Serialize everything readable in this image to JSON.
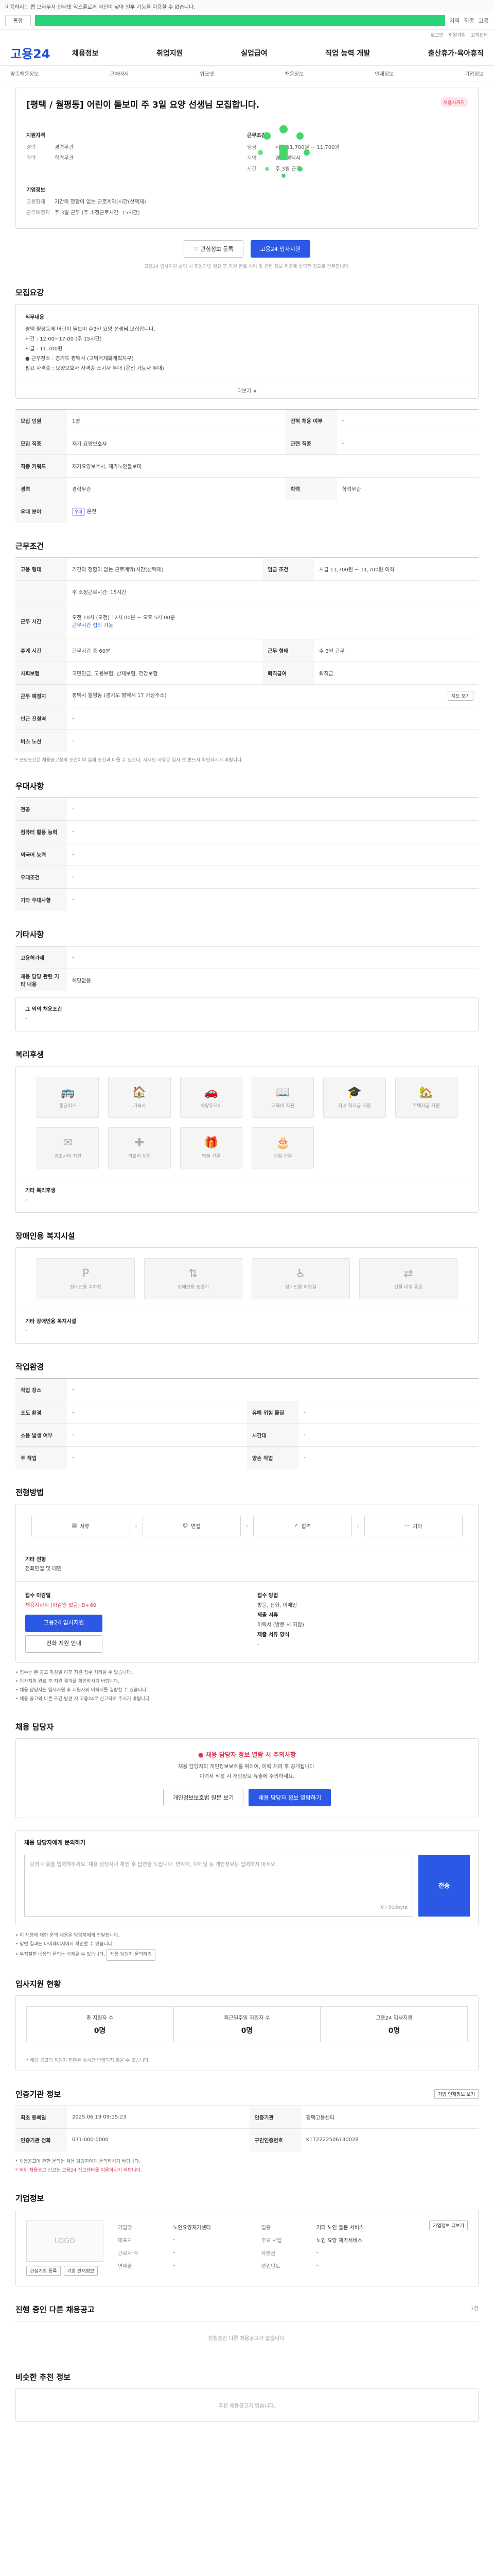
{
  "top_notice": "이용하시는 웹 브라우저 인터넷 익스플로러 버전이 낮아 일부 기능을 이용할 수 없습니다.",
  "search": {
    "scope": "통합",
    "icons": [
      "지역",
      "직종",
      "고용"
    ]
  },
  "top_links": [
    "로그인",
    "회원가입",
    "고객센터"
  ],
  "logo": "고용24",
  "gnb": [
    "채용정보",
    "취업지원",
    "실업급여",
    "직업 능력 개발",
    "출산휴가·육아휴직"
  ],
  "subnav": [
    "맞춤채용정보",
    "근처에서",
    "워크넷",
    "채용정보",
    "인재정보",
    "기업정보"
  ],
  "job": {
    "title": "[평택 / 월평동] 어린이 돌보미 주 3일 요양 선생님 모집합니다.",
    "badge": "채용시까지",
    "recruit_label": "지원자격",
    "conditions_label": "근무조건",
    "company_label": "기업정보",
    "career_k": "경력",
    "career_v": "경력무관",
    "edu_k": "학력",
    "edu_v": "학력무관",
    "wage_k": "임금",
    "wage_v": "시급 11,700원 ~ 11,700원",
    "region_k": "지역",
    "region_v": "경기 평택시",
    "time_k": "시간",
    "time_v": "주 3일 근무",
    "emp_k": "고용형태",
    "emp_v": "기간의 정함이 없는 근로계약(시간(선택제)",
    "loc_k": "근무예정지",
    "loc_v": "주 3일 근무 (주 소정근로시간: 15시간)",
    "btn_save": "관심정보 등록",
    "btn_apply": "고용24 입사지원",
    "notice": "고용24 입사지원 클릭 시 회원가입 필요 후 지원 완료 처리 및 관련 정보 제공에 동의한 것으로 간주합니다."
  },
  "detail": {
    "title": "모집요강",
    "text_title": "직무내용",
    "lines": [
      "평택 월평동에 어린이 돌보미 주3일 요양 선생님 모집합니다.",
      "시간 : 12:00~17:00 (주 15시간)",
      "시급 : 11,700원",
      "● 근무장소 : 경기도 평택시 (고덕국제화계획지구)",
      "필요 자격증 : 요양보호사 자격증 소지자 우대 (운전 가능자 우대)"
    ],
    "more": "더보기 ∨",
    "rows": [
      [
        "모집 인원",
        "1명",
        "전혀 채용 여부",
        "-"
      ],
      [
        "모집 직종",
        "재가 요양보호사",
        "관련 직종",
        "-"
      ],
      [
        "직종 키워드",
        "재가요양보호사, 재가노인돌보미",
        "",
        ""
      ],
      [
        "경력",
        "경력무관",
        "학력",
        "학력무관"
      ],
      [
        "우대 분야",
        "운전",
        "",
        ""
      ]
    ],
    "tag": "우대"
  },
  "work": {
    "title": "근무조건",
    "rows": [
      [
        "고용 형태",
        "기간의 정함이 없는 근로계약(시간(선택제)",
        "임금 조건",
        "시급 11,700원 ~ 11,700원 이하"
      ],
      [
        "",
        "주 소정근로시간: 15시간",
        "",
        ""
      ],
      [
        "근무 시간",
        "오전 10시 (오전) 12시 00분 ~ 오후 5시 00분",
        "",
        ""
      ],
      [
        "",
        "근무시간 협의 가능",
        "",
        ""
      ],
      [
        "휴게 시간",
        "근무시간 중 60분",
        "근무 형태",
        "주 3일 근무"
      ],
      [
        "사회보험",
        "국민연금, 고용보험, 산재보험, 건강보험",
        "퇴직급여",
        "퇴직금"
      ],
      [
        "근무 예정지",
        "평택시 월평동 (경기도 평택시 17 가상주소)",
        "",
        ""
      ],
      [
        "인근 전철역",
        "-",
        "",
        ""
      ],
      [
        "버스 노선",
        "-",
        "",
        ""
      ]
    ],
    "map_btn": "지도 보기",
    "foot": "* 근로조건은 채용공고상의 조건이며 실제 조건과 다를 수 있으니, 자세한 사항은 입사 전 반드시 확인하시기 바랍니다."
  },
  "prefs": {
    "title": "우대사항",
    "rows": [
      [
        "전공",
        "-"
      ],
      [
        "컴퓨터 활용 능력",
        "-"
      ],
      [
        "외국어 능력",
        "-"
      ],
      [
        "우대조건",
        "-"
      ],
      [
        "기타 우대사항",
        "-"
      ]
    ]
  },
  "extra": {
    "title": "기타사항",
    "rows": [
      [
        "고용허가제",
        "-"
      ],
      [
        "채용 담당 관련 기타 내용",
        "해당없음"
      ]
    ],
    "sub": "그 외의 채용조건",
    "sub_v": "-"
  },
  "welfare": {
    "title": "복리후생",
    "items": [
      "통근버스",
      "기숙사",
      "차량유지비",
      "교육비 지원",
      "자녀 학자금 지원",
      "주택자금 지원",
      "경조사비 지원",
      "의료비 지원",
      "명절 선물",
      "생일 선물"
    ],
    "other": "기타 복리후생",
    "other_v": "-"
  },
  "disabled": {
    "title": "장애인용 복지시설",
    "items": [
      "장애인용 주차장",
      "장애인용 승강기",
      "장애인용 화장실",
      "건물 내부 통로"
    ],
    "other": "기타 장애인용 복지시설",
    "other_v": "-"
  },
  "env": {
    "title": "작업환경",
    "rows": [
      [
        "작업 장소",
        "-",
        "",
        ""
      ],
      [
        "조도 환경",
        "-",
        "유해 위험 물질",
        "-"
      ],
      [
        "소음 발생 여부",
        "-",
        "시간대",
        "-"
      ],
      [
        "주 작업",
        "-",
        "양손 작업",
        "-"
      ]
    ]
  },
  "process": {
    "title": "전형방법",
    "steps": [
      "서류",
      "면접",
      "합격",
      "기타"
    ],
    "extra_title": "기타 전형",
    "extra_v": "전화면접 및 대면",
    "apply_period_label": "접수 마감일",
    "apply_period": "채용시까지 (마감일 없음)",
    "dday": "D+60",
    "btn_apply": "고용24 입사지원",
    "btn_call": "전화 지원 안내",
    "method_label": "접수 방법",
    "method": "방문, 전화, 이메일",
    "contact_label": "제출 서류",
    "contact": "이력서 (방문 시 지참)",
    "doc_label": "제출 서류 양식",
    "doc": "-",
    "bullets": [
      "• 접수는 본 공고 마감일 이후 지원 접수 처리될 수 있습니다.",
      "• 입사지원 완료 후 지원 결과를 확인하시기 바랍니다.",
      "• 채용 담당자는 입사지원 후 지원자의 이력서를 열람할 수 있습니다.",
      "• 채용 공고와 다른 조건 발견 시 고용24로 신고하여 주시기 바랍니다."
    ]
  },
  "contact_sec": {
    "title": "채용 담당자",
    "warn": "채용 담당자 정보 열람 시 주의사항",
    "desc1": "채용 담당자의 개인정보보호를 위하여, 이력 처리 후 공개됩니다.",
    "desc2": "이력서 작성 시 개인정보 유출에 주의하세요.",
    "btn1": "개인정보보호법 원문 보기",
    "btn2": "채용 담당자 정보 열람하기"
  },
  "qna": {
    "title": "채용 담당자에게 문의하기",
    "placeholder": "문의 내용을 입력해주세요. 채용 담당자가 확인 후 답변을 드립니다. 연락처, 이메일 등 개인정보는 입력하지 마세요.",
    "count": "0 / 500byte",
    "send": "전송",
    "bullets": [
      "• 이 채용에 대한 문의 내용은 담당자에게 전달됩니다.",
      "• 답변 결과는 마이페이지에서 확인할 수 있습니다.",
      "• 부적절한 내용의 문의는 삭제될 수 있습니다."
    ],
    "more_btn": "채용 담당자 문의하기"
  },
  "stats": {
    "title": "입사지원 현황",
    "items": [
      [
        "총 지원자 수",
        "0명"
      ],
      [
        "최근일주일 지원자 수",
        "0명"
      ],
      [
        "고용24 입사지원",
        "0명"
      ]
    ],
    "note": "* 해당 공고의 지원자 현황은 실시간 반영되지 않을 수 있습니다."
  },
  "org": {
    "title": "인증기관 정보",
    "btn": "기업 인재정보 보기",
    "rows": [
      [
        "최초 등록일",
        "2025.06.19 09:15:23",
        "인증기관",
        "평택고용센터"
      ],
      [
        "인증기관 전화",
        "031-000-0000",
        "구인인증번호",
        "K172222506130028"
      ]
    ],
    "notes": [
      "* 채용공고에 관한 문의는 채용 담당자에게 문의하시기 바랍니다.",
      "* 허위 채용공고 신고는 고용24 신고센터를 이용하시기 바랍니다."
    ]
  },
  "company": {
    "title": "기업정보",
    "logo": "LOGO",
    "btn1": "관심기업 등록",
    "btn2": "기업 인재정보",
    "rows": [
      [
        "기업명",
        "노인요양재가센터",
        "업종",
        "기타 노인 돌봄 서비스"
      ],
      [
        "대표자",
        "-",
        "주요 사업",
        "노인 요양 재가서비스"
      ],
      [
        "근로자 수",
        "-",
        "자본금",
        "-"
      ],
      [
        "연매출",
        "-",
        "설립년도",
        "-"
      ]
    ],
    "btn_more": "기업정보 더보기"
  },
  "other_jobs": {
    "title": "진행 중인 다른 채용공고",
    "sub": "1건",
    "empty": "진행중인 다른 채용공고가 없습니다."
  },
  "recommend": {
    "title": "비슷한 추천 정보",
    "empty": "추천 채용공고가 없습니다."
  }
}
